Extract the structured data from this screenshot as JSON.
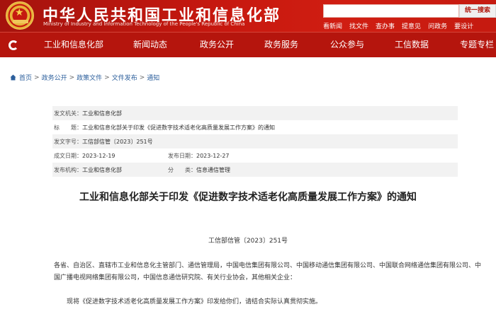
{
  "header": {
    "title_cn": "中华人民共和国工业和信息化部",
    "title_en": "Ministry of Industry and Information Technology of the People's Republic of China",
    "search_button": "统一搜索",
    "top_links": [
      "看新闻",
      "找文件",
      "查办事",
      "提意见",
      "问政务",
      "要设计"
    ]
  },
  "nav": {
    "items": [
      "工业和信息化部",
      "新闻动态",
      "政务公开",
      "政务服务",
      "公众参与",
      "工信数据",
      "专题专栏"
    ]
  },
  "breadcrumb": {
    "items": [
      "首页",
      "政务公开",
      "政策文件",
      "文件发布",
      "通知"
    ],
    "separator": ">"
  },
  "meta": {
    "issuer_label": "发文机关：",
    "issuer": "工业和信息化部",
    "title_label": "标　　题：",
    "title": "工业和信息化部关于印发《促进数字技术适老化高质量发展工作方案》的通知",
    "doc_no_label": "发文字号：",
    "doc_no": "工信部信管〔2023〕251号",
    "created_label": "成文日期：",
    "created": "2023-12-19",
    "published_label": "发布日期：",
    "published": "2023-12-27",
    "agency_label": "发布机构：",
    "agency": "工业和信息化部",
    "category_label": "分　　类：",
    "category": "信息通信管理"
  },
  "article": {
    "title": "工业和信息化部关于印发《促进数字技术适老化高质量发展工作方案》的通知",
    "doc_number": "工信部信管〔2023〕251号",
    "paragraph1": "各省、自治区、直辖市工业和信息化主管部门、通信管理局，中国电信集团有限公司、中国移动通信集团有限公司、中国联合网络通信集团有限公司、中国广播电视网络集团有限公司，中国信息通信研究院、有关行业协会，其他相关企业：",
    "paragraph2": "现将《促进数字技术适老化高质量发展工作方案》印发给你们，请结合实际认真贯彻实施。"
  },
  "colors": {
    "brand_red": "#b5150d",
    "link_blue": "#2c5f9c"
  }
}
